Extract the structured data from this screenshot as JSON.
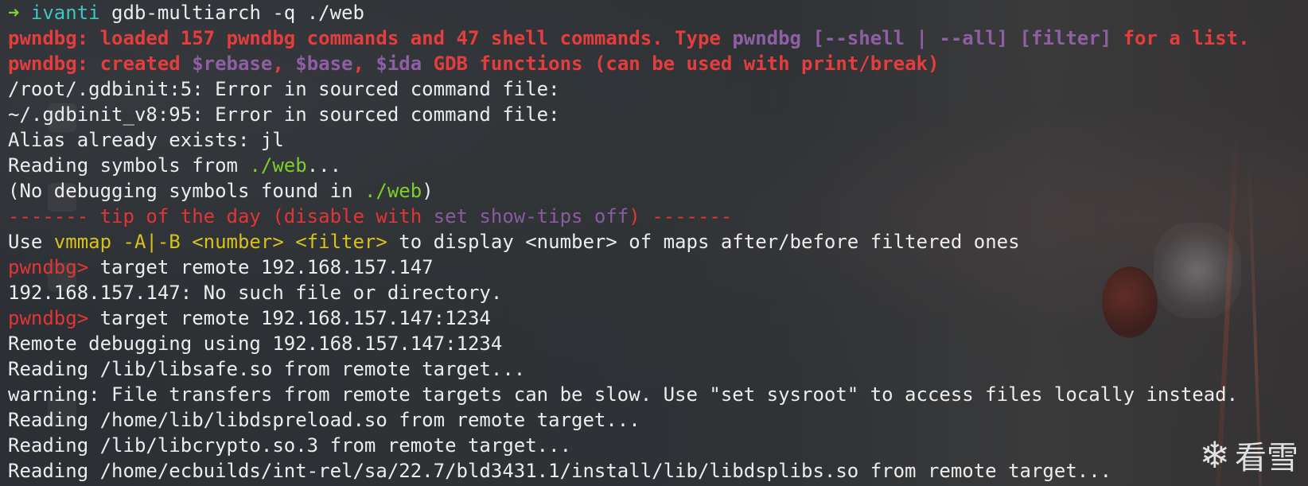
{
  "lines": [
    [
      {
        "t": "➜ ",
        "c": "c-green"
      },
      {
        "t": "ivanti",
        "c": "c-cyan"
      },
      {
        "t": " gdb-multiarch -q ./web",
        "c": "c-white"
      }
    ],
    [
      {
        "t": "pwndbg: ",
        "c": "c-redb"
      },
      {
        "t": "loaded 157 pwndbg commands and 47 shell commands. Type ",
        "c": "c-redb"
      },
      {
        "t": "pwndbg [--shell | --all] [filter]",
        "c": "c-purpleb"
      },
      {
        "t": " for a list.",
        "c": "c-redb"
      }
    ],
    [
      {
        "t": "pwndbg: ",
        "c": "c-redb"
      },
      {
        "t": "created ",
        "c": "c-redb"
      },
      {
        "t": "$rebase",
        "c": "c-purpleb"
      },
      {
        "t": ", ",
        "c": "c-redb"
      },
      {
        "t": "$base",
        "c": "c-purpleb"
      },
      {
        "t": ", ",
        "c": "c-redb"
      },
      {
        "t": "$ida",
        "c": "c-purpleb"
      },
      {
        "t": " GDB functions (can be used with print/break)",
        "c": "c-redb"
      }
    ],
    [
      {
        "t": "/root/.gdbinit:5: Error in sourced command file:",
        "c": "c-white"
      }
    ],
    [
      {
        "t": "~/.gdbinit_v8:95: Error in sourced command file:",
        "c": "c-white"
      }
    ],
    [
      {
        "t": "Alias already exists: jl",
        "c": "c-white"
      }
    ],
    [
      {
        "t": "Reading symbols from ",
        "c": "c-white"
      },
      {
        "t": "./web",
        "c": "c-lgreen"
      },
      {
        "t": "...",
        "c": "c-white"
      }
    ],
    [
      {
        "t": "(No debugging symbols found in ",
        "c": "c-white"
      },
      {
        "t": "./web",
        "c": "c-lgreen"
      },
      {
        "t": ")",
        "c": "c-white"
      }
    ],
    [
      {
        "t": "------- tip of the day (disable with ",
        "c": "c-red"
      },
      {
        "t": "set show-tips off",
        "c": "c-purple"
      },
      {
        "t": ") -------",
        "c": "c-red"
      }
    ],
    [
      {
        "t": "Use ",
        "c": "c-white"
      },
      {
        "t": "vmmap -A|-B <number> <filter>",
        "c": "c-yellow"
      },
      {
        "t": " to display <number> of maps after/before filtered ones",
        "c": "c-white"
      }
    ],
    [
      {
        "t": "pwndbg>",
        "c": "c-red"
      },
      {
        "t": " target remote 192.168.157.147",
        "c": "c-white"
      }
    ],
    [
      {
        "t": "192.168.157.147: No such file or directory.",
        "c": "c-white"
      }
    ],
    [
      {
        "t": "pwndbg>",
        "c": "c-red"
      },
      {
        "t": " target remote 192.168.157.147:1234",
        "c": "c-white"
      }
    ],
    [
      {
        "t": "Remote debugging using 192.168.157.147:1234",
        "c": "c-white"
      }
    ],
    [
      {
        "t": "Reading /lib/libsafe.so from remote target...",
        "c": "c-white"
      }
    ],
    [
      {
        "t": "warning: File transfers from remote targets can be slow. Use \"set sysroot\" to access files locally instead.",
        "c": "c-white"
      }
    ],
    [
      {
        "t": "Reading /home/lib/libdspreload.so from remote target...",
        "c": "c-white"
      }
    ],
    [
      {
        "t": "Reading /lib/libcrypto.so.3 from remote target...",
        "c": "c-white"
      }
    ],
    [
      {
        "t": "Reading /home/ecbuilds/int-rel/sa/22.7/bld3431.1/install/lib/libdsplibs.so from remote target...",
        "c": "c-white"
      }
    ]
  ],
  "watermark": {
    "icon": "snowflake-icon",
    "glyph": "❄",
    "text": "看雪"
  }
}
